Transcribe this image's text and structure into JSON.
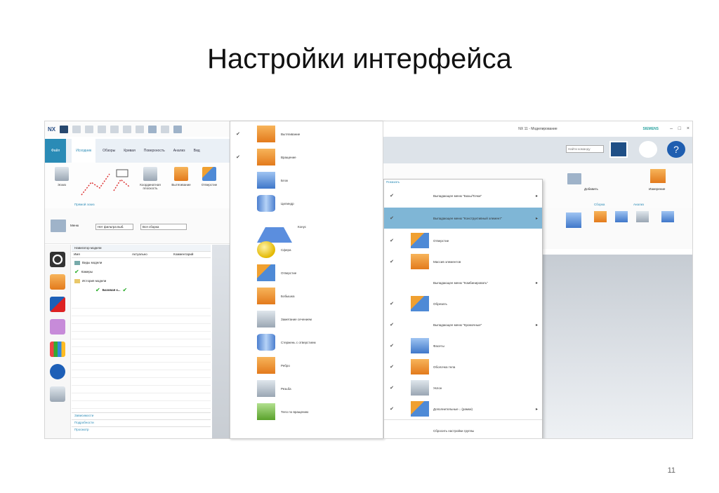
{
  "slide": {
    "title": "Настройки интерфейса",
    "page_number": "11"
  },
  "left_window": {
    "logo": "NX",
    "tabs": [
      "Файл",
      "Исходник",
      "Обзоры",
      "Кривая",
      "Поверхность",
      "Анализ",
      "Вид"
    ],
    "ribbon": {
      "buttons": [
        "Эскиз",
        "Координатная плоскость",
        "Вытягивание",
        "Отверстие"
      ],
      "group_label": "Прямой эскиз"
    },
    "filter": {
      "menu_label": "Меню",
      "filter_value": "Нет фильтра выб.",
      "assembly_value": "Вся сборка"
    },
    "navigator": {
      "title": "Навигатор модели",
      "columns": [
        "Имя",
        "Актуально",
        "Комментарий"
      ],
      "rows": [
        "Виды модели",
        "Камеры",
        "История модели",
        "Базовая к..."
      ],
      "sections": [
        "Зависимости",
        "Подробности",
        "Просмотр"
      ]
    }
  },
  "middle_menu": {
    "items": [
      "Вытягивание",
      "Вращение",
      "Блок",
      "Цилиндр",
      "Конус",
      "Сфера",
      "Отверстие",
      "Бобышка",
      "Заметание сечением",
      "Стержень с отверстием",
      "Ребро",
      "Резьба",
      "Тело по вращению"
    ]
  },
  "right_window": {
    "title": "NX 11 - Моделирование",
    "brand": "SIEMENS",
    "search_placeholder": "Найти команду",
    "ribbon_labels": [
      "Добавить",
      "Сборка",
      "Анализ",
      "Измерение"
    ],
    "menu_header": "Показать",
    "menu_items": [
      {
        "label": "Выпадающее меню \"Базы/Точки\"",
        "checked": true,
        "submenu": true
      },
      {
        "label": "Выпадающее меню \"Конструктивный элемент\"",
        "checked": true,
        "submenu": true,
        "highlighted": true
      },
      {
        "label": "Отверстие",
        "checked": true
      },
      {
        "label": "Массив элементов",
        "checked": true
      },
      {
        "label": "Выпадающее меню \"Комбинировать\"",
        "checked": false,
        "submenu": true
      },
      {
        "label": "Обрезать",
        "checked": true
      },
      {
        "label": "Выпадающее меню \"Кромочные\"",
        "checked": true,
        "submenu": true
      },
      {
        "label": "Фасеты",
        "checked": true
      },
      {
        "label": "Оболочка тела",
        "checked": true
      },
      {
        "label": "Уклон",
        "checked": true
      },
      {
        "label": "Дополнительные ↓ (рамки)",
        "checked": true,
        "submenu": true
      },
      {
        "label": "Сбросить настройки группы",
        "checked": false
      }
    ]
  }
}
